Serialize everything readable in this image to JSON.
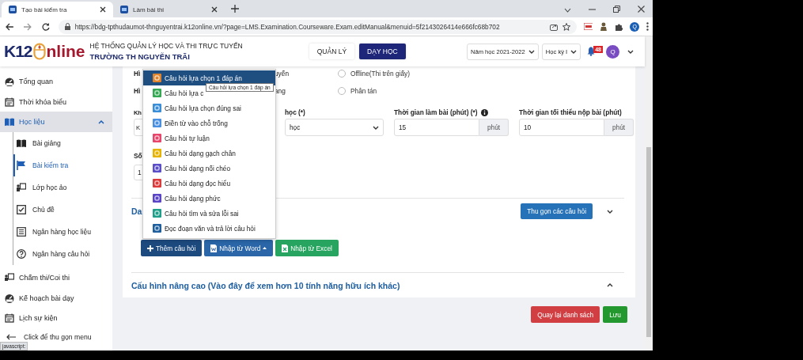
{
  "browser": {
    "tabs": [
      {
        "title": "Tạo bài kiểm tra",
        "selected": true
      },
      {
        "title": "Làm bài thi",
        "selected": false
      }
    ],
    "url": "https://bdg-tpthudaumot-thnguyentrai.k12online.vn/?page=LMS.Examination.Courseware.Exam.editManual&menuid=5f2143026414e666fc68b702",
    "profile_initial": "Q",
    "status_text": "javascript:"
  },
  "header": {
    "logo_left": "K12",
    "logo_right": "nline",
    "system_name": "HỆ THỐNG QUẢN LÝ HỌC VÀ THI TRỰC TUYẾN",
    "school_name": "TRƯỜNG TH NGUYỄN TRÃI",
    "nav": [
      {
        "label": "QUẢN LÝ",
        "selected": false
      },
      {
        "label": "DẠY HỌC",
        "selected": true
      }
    ],
    "school_year": "Năm học 2021-2022",
    "semester": "Học kỳ I",
    "notification_count": "48",
    "avatar": "Q"
  },
  "sidebar": {
    "items": [
      {
        "label": "Tổng quan",
        "selected": false
      },
      {
        "label": "Thời khóa biểu",
        "selected": false
      },
      {
        "label": "Học liệu",
        "selected": true,
        "expanded": true,
        "children": [
          {
            "label": "Bài giảng",
            "selected": false
          },
          {
            "label": "Bài kiểm tra",
            "selected": true
          },
          {
            "label": "Lớp học ảo",
            "selected": false
          },
          {
            "label": "Chủ đề",
            "selected": false
          },
          {
            "label": "Ngân hàng học liệu",
            "selected": false
          },
          {
            "label": "Ngân hàng câu hỏi",
            "selected": false
          }
        ]
      },
      {
        "label": "Chấm thi/Coi thi",
        "selected": false
      },
      {
        "label": "Kế hoạch bài dạy",
        "selected": false
      },
      {
        "label": "Lịch sự kiện",
        "selected": false
      }
    ],
    "collapse_label": "Click để thu gọn menu"
  },
  "form": {
    "option_rows": [
      {
        "label_fragment": "Hì",
        "choice_fragment": "uyến",
        "radio_label": "Offline(Thi trên giấy)",
        "selected": false
      },
      {
        "label_fragment": "Hì",
        "choice_fragment": "ang",
        "radio_label": "Phân tán",
        "selected": false
      }
    ],
    "fields": [
      {
        "kind": "partial",
        "label": "Kh",
        "value": "K"
      },
      {
        "kind": "select",
        "label": "học (*)",
        "value": "học"
      },
      {
        "kind": "unit",
        "label": "Thời gian làm bài (phút) (*)",
        "info": true,
        "value": "15",
        "unit": "phút"
      },
      {
        "kind": "unit",
        "label": "Thời gian tối thiểu nộp bài (phút)",
        "info": false,
        "value": "10",
        "unit": "phút"
      }
    ],
    "count_field": {
      "label": "Số",
      "value": "1"
    }
  },
  "questions_section": {
    "title_fragment": "Da",
    "collapse_button": "Thu gọn các câu hỏi"
  },
  "question_menu": {
    "items": [
      {
        "label": "Câu hỏi lựa chọn 1 đáp án",
        "color": "#e0852e",
        "selected": true
      },
      {
        "label": "Câu hỏi lựa c",
        "color": "#34a853",
        "selected": false
      },
      {
        "label": "Câu hỏi lựa chọn đúng sai",
        "color": "#3a8ed8",
        "selected": false
      },
      {
        "label": "Điền từ vào chỗ trống",
        "color": "#4a90e2",
        "selected": false
      },
      {
        "label": "Câu hỏi tự luận",
        "color": "#e8456c",
        "selected": false
      },
      {
        "label": "Câu hỏi dạng gạch chân",
        "color": "#e6b400",
        "selected": false
      },
      {
        "label": "Câu hỏi dạng nối chéo",
        "color": "#5a4fc8",
        "selected": false
      },
      {
        "label": "Câu hỏi dạng đọc hiểu",
        "color": "#dc3b3b",
        "selected": false
      },
      {
        "label": "Câu hỏi dạng phức",
        "color": "#5b45c6",
        "selected": false
      },
      {
        "label": "Câu hỏi tìm và sửa lỗi sai",
        "color": "#1f9f8a",
        "selected": false
      },
      {
        "label": "Đọc đoạn văn và trả lời câu hỏi",
        "color": "#1f5f9e",
        "selected": false
      }
    ],
    "tooltip": "Câu hỏi lựa chọn 1 đáp án"
  },
  "add_buttons": [
    {
      "label": "Thêm câu hỏi",
      "kind": "add"
    },
    {
      "label": "Nhập từ Word",
      "kind": "word"
    },
    {
      "label": "Nhập từ Excel",
      "kind": "excel"
    }
  ],
  "advanced": {
    "title": "Cấu hình nâng cao (Vào đây để xem hơn 10 tính năng hữu ích khác)"
  },
  "actions": [
    {
      "label": "Quay lại danh sách",
      "kind": "back"
    },
    {
      "label": "Lưu",
      "kind": "save"
    }
  ]
}
